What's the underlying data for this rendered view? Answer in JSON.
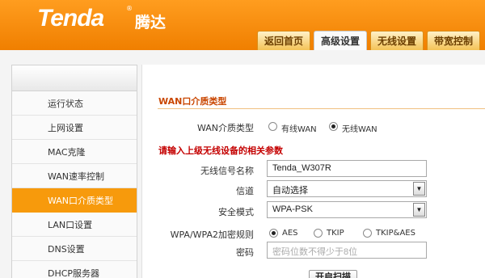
{
  "brand": {
    "logo": "Tenda",
    "logo_cn": "腾达",
    "reg": "®"
  },
  "tabs": [
    {
      "label": "返回首页"
    },
    {
      "label": "高级设置"
    },
    {
      "label": "无线设置"
    },
    {
      "label": "带宽控制"
    }
  ],
  "sidebar": {
    "items": [
      {
        "label": "运行状态"
      },
      {
        "label": "上网设置"
      },
      {
        "label": "MAC克隆"
      },
      {
        "label": "WAN速率控制"
      },
      {
        "label": "WAN口介质类型"
      },
      {
        "label": "LAN口设置"
      },
      {
        "label": "DNS设置"
      },
      {
        "label": "DHCP服务器"
      }
    ],
    "active_index": 4
  },
  "main": {
    "section_title": "WAN口介质类型",
    "wan_type": {
      "label": "WAN介质类型",
      "options": [
        "有线WAN",
        "无线WAN"
      ],
      "selected": "无线WAN"
    },
    "hint": "请输入上级无线设备的相关参数",
    "ssid": {
      "label": "无线信号名称",
      "value": "Tenda_W307R"
    },
    "channel": {
      "label": "信道",
      "value": "自动选择"
    },
    "security": {
      "label": "安全模式",
      "value": "WPA-PSK"
    },
    "cipher": {
      "label": "WPA/WPA2加密规则",
      "options": [
        "AES",
        "TKIP",
        "TKIP&AES"
      ],
      "selected": "AES"
    },
    "password": {
      "label": "密码",
      "placeholder": "密码位数不得少于8位"
    },
    "scan_button": "开启扫描"
  },
  "colors": {
    "accent": "#f79a0c",
    "header": "#f58b07",
    "title": "#c94600",
    "hint": "#c40000"
  }
}
